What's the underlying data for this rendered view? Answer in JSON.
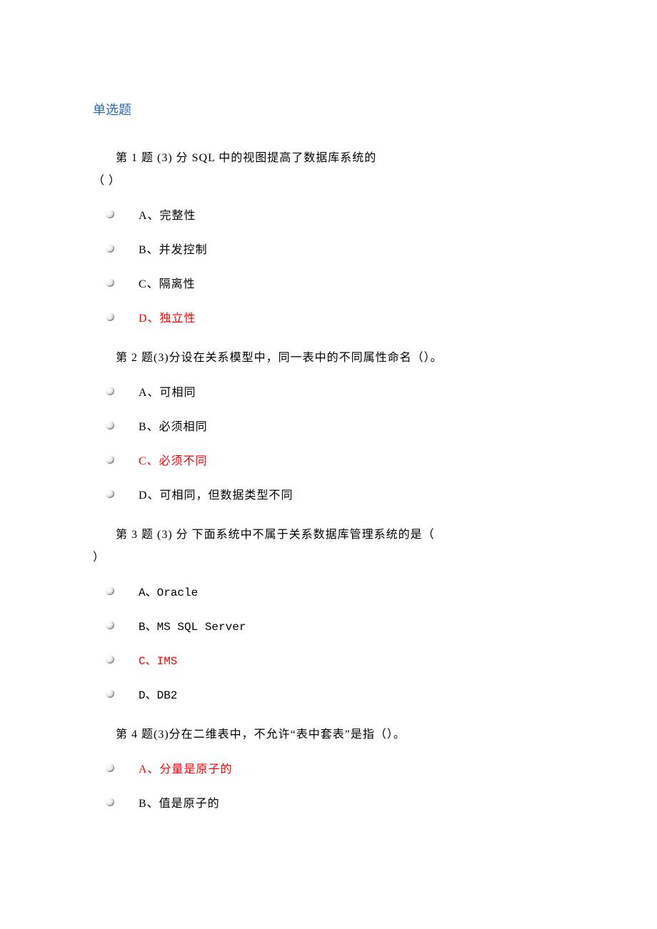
{
  "heading": "单选题",
  "questions": [
    {
      "prompt_line1": "第 1 题  (3)  分  SQL 中的视图提高了数据库系统的",
      "prompt_line2": "（ ）",
      "options": [
        {
          "label": "A、完整性",
          "answer": false
        },
        {
          "label": "B、并发控制",
          "answer": false
        },
        {
          "label": "C、隔离性",
          "answer": false
        },
        {
          "label": "D、独立性",
          "answer": true
        }
      ]
    },
    {
      "prompt_line1": "第 2 题(3)分设在关系模型中，同一表中的不同属性命名（）。",
      "prompt_line2": "",
      "options": [
        {
          "label": "A、可相同",
          "answer": false
        },
        {
          "label": "B、必须相同",
          "answer": false
        },
        {
          "label": "C、必须不同",
          "answer": true
        },
        {
          "label": "D、可相同，但数据类型不同",
          "answer": false
        }
      ]
    },
    {
      "prompt_line1": "第 3 题  (3)  分  下面系统中不属于关系数据库管理系统的是（",
      "prompt_line2": "）",
      "options": [
        {
          "label": "A、Oracle",
          "answer": false,
          "mono": true
        },
        {
          "label": "B、MS SQL Server",
          "answer": false,
          "mono": true
        },
        {
          "label": "C、IMS",
          "answer": true,
          "mono": true
        },
        {
          "label": "D、DB2",
          "answer": false,
          "mono": true
        }
      ]
    },
    {
      "prompt_line1": "第 4 题(3)分在二维表中，不允许“表中套表”是指（）。",
      "prompt_line2": "",
      "options": [
        {
          "label": "A、分量是原子的",
          "answer": true
        },
        {
          "label": "B、值是原子的",
          "answer": false
        }
      ]
    }
  ]
}
